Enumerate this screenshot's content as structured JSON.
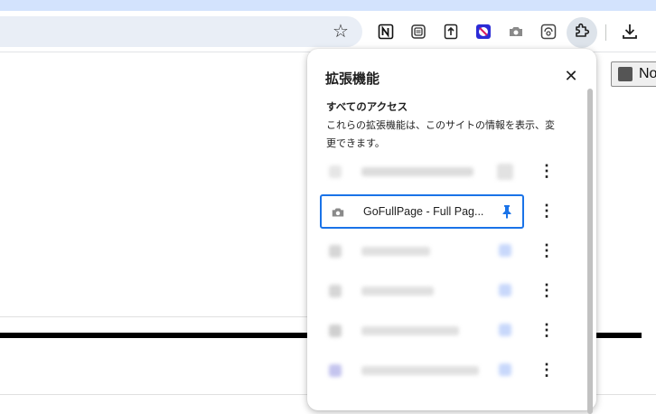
{
  "browser": {
    "accent_color": "#d3e3fd",
    "bookmark_icon": "star-icon",
    "pinned_extensions": [
      "notion-icon",
      "notebook-icon",
      "upload-icon",
      "blocked-icon",
      "camera-icon",
      "screenshot-icon"
    ],
    "extensions_button_icon": "puzzle-icon",
    "download_icon": "download-icon"
  },
  "page": {
    "partial_button_label": "No"
  },
  "extensions_popup": {
    "title": "拡張機能",
    "close_icon": "close-icon",
    "section_title": "すべてのアクセス",
    "section_description": "これらの拡張機能は、このサイトの情報を表示、変更できます。",
    "items": [
      {
        "name": "",
        "blurred": true,
        "pinned": false
      },
      {
        "name": "GoFullPage - Full Pag...",
        "blurred": false,
        "pinned": true,
        "icon": "camera-icon",
        "focused": true
      },
      {
        "name": "",
        "blurred": true,
        "pinned": true
      },
      {
        "name": "",
        "blurred": true,
        "pinned": true
      },
      {
        "name": "",
        "blurred": true,
        "pinned": true
      },
      {
        "name": "",
        "blurred": true,
        "pinned": true
      }
    ],
    "pin_color": "#1a73e8",
    "focus_color": "#1a73e8"
  }
}
